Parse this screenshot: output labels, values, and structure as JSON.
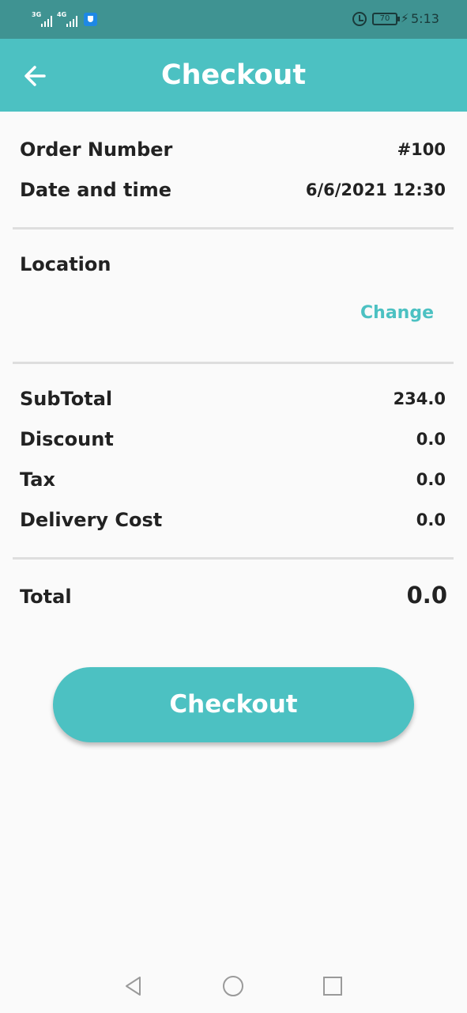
{
  "status_bar": {
    "net1": "3G",
    "net2": "4G",
    "battery": "70",
    "time": "5:13"
  },
  "app_bar": {
    "title": "Checkout"
  },
  "order": {
    "number_label": "Order Number",
    "number_value": "#100",
    "datetime_label": "Date and time",
    "datetime_value": "6/6/2021 12:30"
  },
  "location": {
    "label": "Location",
    "change_label": "Change"
  },
  "summary": {
    "subtotal_label": "SubTotal",
    "subtotal_value": "234.0",
    "discount_label": "Discount",
    "discount_value": "0.0",
    "tax_label": "Tax",
    "tax_value": "0.0",
    "delivery_label": "Delivery Cost",
    "delivery_value": "0.0"
  },
  "total": {
    "label": "Total",
    "value": "0.0"
  },
  "checkout_button": {
    "label": "Checkout"
  },
  "colors": {
    "accent": "#4cc1c2",
    "status_bar": "#3f9392"
  },
  "icons": {
    "back": "arrow-left-icon",
    "nav_back": "triangle-back-icon",
    "nav_home": "circle-home-icon",
    "nav_recents": "square-recents-icon"
  }
}
